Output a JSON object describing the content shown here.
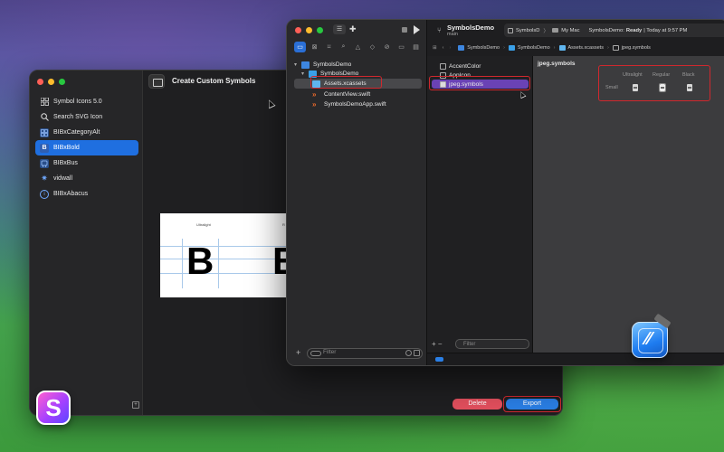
{
  "left_app": {
    "title": "Create Custom Symbols",
    "sidebar_items": [
      {
        "label": "Symbol Icons 5.0",
        "icon": "grid-icon"
      },
      {
        "label": "Search SVG Icon",
        "icon": "search-icon"
      },
      {
        "label": "BIBxCategoryAlt",
        "icon": "category-icon"
      },
      {
        "label": "BIBxBold",
        "icon": "bold-b-icon"
      },
      {
        "label": "BIBxBus",
        "icon": "bus-icon"
      },
      {
        "label": "vidwall",
        "icon": "gear-icon"
      },
      {
        "label": "BIBxAbacus",
        "icon": "info-icon"
      }
    ],
    "active_index": 3,
    "preview": {
      "col1_label": "Ultralight",
      "col2_label": "R",
      "glyph": "B"
    },
    "delete_label": "Delete",
    "export_label": "Export",
    "colors": {
      "delete": "#e4505e",
      "export": "#2a7fe6",
      "selection": "#1f6fe0"
    }
  },
  "dock_app_letter": "S",
  "xcode": {
    "scheme_title": "SymbolsDemo",
    "branch": "main",
    "status": {
      "target": "SymbolsD",
      "destination": "My Mac",
      "message_prefix": "SymbolsDemo:",
      "message_state": "Ready",
      "message_time": "| Today at 9:57 PM"
    },
    "navigator": [
      {
        "label": "SymbolsDemo",
        "kind": "project",
        "indent": 0
      },
      {
        "label": "SymbolsDemo",
        "kind": "folder",
        "indent": 1
      },
      {
        "label": "Assets.xcassets",
        "kind": "assets",
        "indent": 2
      },
      {
        "label": "ContentView.swift",
        "kind": "swift",
        "indent": 2
      },
      {
        "label": "SymbolsDemoApp.swift",
        "kind": "swift",
        "indent": 2
      }
    ],
    "filter_placeholder": "Filter",
    "jumpbar": [
      "SymbolsDemo",
      "SymbolsDemo",
      "Assets.xcassets",
      "jpeg.symbols"
    ],
    "asset_list": [
      "AccentColor",
      "AppIcon",
      "jpeg.symbols"
    ],
    "asset_filter_placeholder": "Filter",
    "editor": {
      "title": "jpeg.symbols",
      "columns": [
        "Ultralight",
        "Regular",
        "Black"
      ],
      "row_label": "Small"
    }
  }
}
